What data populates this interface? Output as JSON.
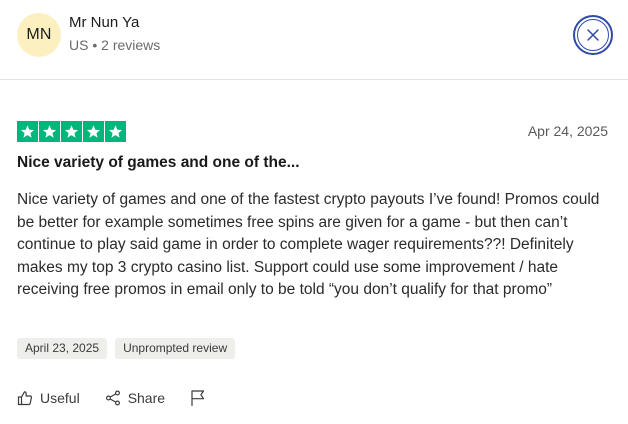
{
  "reviewer": {
    "initials": "MN",
    "name": "Mr Nun Ya",
    "country": "US",
    "reviews": "2 reviews"
  },
  "review": {
    "rating": 5,
    "date": "Apr 24, 2025",
    "title": "Nice variety of games and one of the...",
    "body": "Nice variety of games and one of the fastest crypto payouts I’ve found! Promos could be better for example sometimes free spins are given for a game - but then can’t continue to play said game in order to complete wager requirements??! Definitely makes my top 3 crypto casino list. Support could use some improvement / hate receiving free promos in email only to be told “you don’t qualify for that promo”",
    "experience_date": "April 23, 2025",
    "tag": "Unprompted review"
  },
  "actions": {
    "useful": "Useful",
    "share": "Share"
  },
  "colors": {
    "star_green": "#00b67a",
    "avatar_bg": "#fdf0c0",
    "close_blue": "#2f4aa8"
  }
}
